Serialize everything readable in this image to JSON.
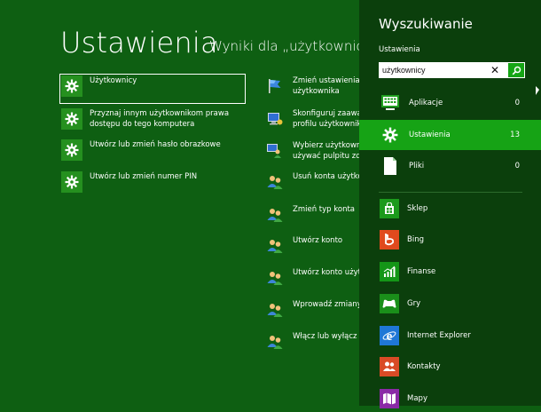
{
  "header": {
    "title": "Ustawienia",
    "subtitle": "Wyniki dla „użytkownicy”"
  },
  "results_left": [
    {
      "label": "Użytkownicy",
      "icon": "gear-icon",
      "selected": true
    },
    {
      "label": "Przyznaj innym użytkownikom prawa dostępu do tego komputera",
      "icon": "gear-icon"
    },
    {
      "label": "Utwórz lub zmień hasło obrazkowe",
      "icon": "gear-icon"
    },
    {
      "label": "Utwórz lub zmień numer PIN",
      "icon": "gear-icon"
    }
  ],
  "results_right": [
    {
      "label": "Zmień ustawienia fu użytkownika",
      "icon": "flag-icon"
    },
    {
      "label": "Skonfiguruj zaawans profilu użytkownika",
      "icon": "computer-icon"
    },
    {
      "label": "Wybierz użytkownik używać pulpitu zdal",
      "icon": "computer-users-icon"
    },
    {
      "label": "Usuń konta użytkow",
      "icon": "users-icon"
    },
    {
      "label": "Zmień typ konta",
      "icon": "users-icon"
    },
    {
      "label": "Utwórz konto",
      "icon": "users-icon"
    },
    {
      "label": "Utwórz konto użytk",
      "icon": "users-icon"
    },
    {
      "label": "Wprowadź zmiany w",
      "icon": "users-icon"
    },
    {
      "label": "Włącz lub wyłącz ko",
      "icon": "users-icon"
    }
  ],
  "search_pane": {
    "title": "Wyszukiwanie",
    "scope": "Ustawienia",
    "query": "użytkownicy",
    "clear_glyph": "✕",
    "scopes": [
      {
        "label": "Aplikacje",
        "count": "0",
        "icon": "apps-icon"
      },
      {
        "label": "Ustawienia",
        "count": "13",
        "icon": "gear-icon",
        "active": true
      },
      {
        "label": "Pliki",
        "count": "0",
        "icon": "file-icon"
      }
    ],
    "apps": [
      {
        "label": "Sklep",
        "icon": "store-icon",
        "color": "#1c9a1c"
      },
      {
        "label": "Bing",
        "icon": "bing-icon",
        "color": "#e04a1e"
      },
      {
        "label": "Finanse",
        "icon": "finance-icon",
        "color": "#149617"
      },
      {
        "label": "Gry",
        "icon": "games-icon",
        "color": "#1a8f1a"
      },
      {
        "label": "Internet Explorer",
        "icon": "ie-icon",
        "color": "#1f77d6"
      },
      {
        "label": "Kontakty",
        "icon": "contacts-icon",
        "color": "#d94b26"
      },
      {
        "label": "Mapy",
        "icon": "maps-icon",
        "color": "#8a2aa6"
      }
    ]
  },
  "colors": {
    "background": "#0e5f12",
    "pane": "#0b3f0c",
    "active_scope": "#16a315",
    "settings_tile": "#25901f"
  }
}
